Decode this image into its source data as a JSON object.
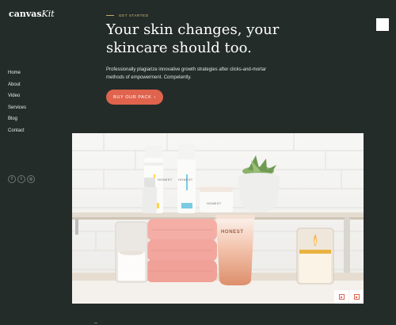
{
  "brand": {
    "name_bold": "canvas",
    "name_italic": "Kit"
  },
  "nav": {
    "items": [
      "Home",
      "About",
      "Video",
      "Services",
      "Blog",
      "Contact"
    ]
  },
  "social": [
    {
      "icon": "facebook-icon",
      "glyph": "f"
    },
    {
      "icon": "twitter-icon",
      "glyph": "t"
    },
    {
      "icon": "instagram-icon",
      "glyph": "◎"
    }
  ],
  "hero": {
    "eyebrow": "GET STARTED",
    "title_line1": "Your skin changes, your",
    "title_line2": "skincare should too.",
    "description_line1": "Professionally plagiarize innovative growth strategies after clicks-and-mortar",
    "description_line2": "methods of empowerment. Competently.",
    "cta_label": "BUY OUR PACK",
    "cta_arrow": "›"
  },
  "product_labels": {
    "brand_print": "HONEST"
  },
  "colors": {
    "background": "#242c2a",
    "accent": "#e0634d",
    "eyebrow": "#d7b978"
  }
}
